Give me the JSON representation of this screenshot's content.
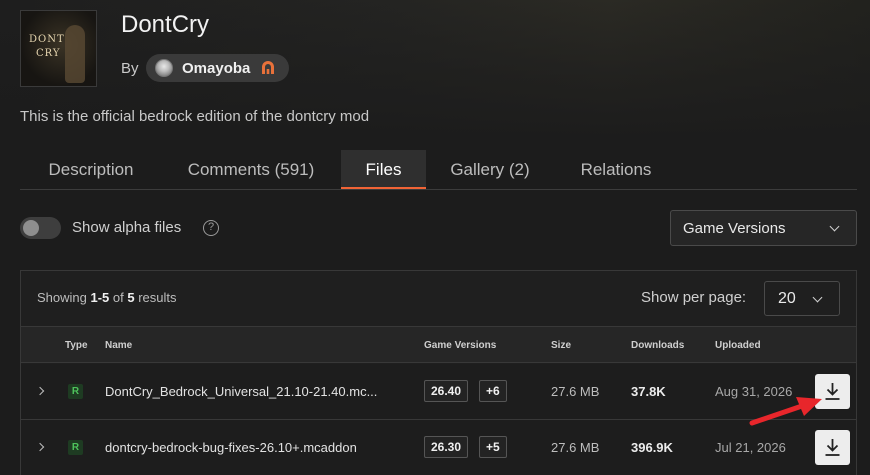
{
  "project": {
    "title": "DontCry",
    "thumb_text_1": "DONT",
    "thumb_text_2": "CRY",
    "by_label": "By",
    "author": "Omayoba",
    "description": "This is the official bedrock edition of the dontcry mod"
  },
  "tabs": [
    {
      "label": "Description",
      "active": false
    },
    {
      "label": "Comments (591)",
      "active": false
    },
    {
      "label": "Files",
      "active": true
    },
    {
      "label": "Gallery (2)",
      "active": false
    },
    {
      "label": "Relations",
      "active": false
    }
  ],
  "filters": {
    "alpha_label": "Show alpha files",
    "alpha_enabled": false,
    "help_glyph": "?",
    "game_versions_label": "Game Versions"
  },
  "results": {
    "showing_prefix": "Showing ",
    "range": "1-5",
    "of_text": " of ",
    "total": "5",
    "suffix": " results",
    "per_page_label": "Show per page:",
    "per_page_value": "20"
  },
  "table": {
    "columns": [
      "Type",
      "Name",
      "Game Versions",
      "Size",
      "Downloads",
      "Uploaded"
    ],
    "rows": [
      {
        "type": "R",
        "name": "DontCry_Bedrock_Universal_21.10-21.40.mc...",
        "version": "26.40",
        "extra_versions": "+6",
        "size": "27.6 MB",
        "downloads": "37.8K",
        "uploaded": "Aug 31, 2026"
      },
      {
        "type": "R",
        "name": "dontcry-bedrock-bug-fixes-26.10+.mcaddon",
        "version": "26.30",
        "extra_versions": "+5",
        "size": "27.6 MB",
        "downloads": "396.9K",
        "uploaded": "Jul 21, 2026"
      }
    ]
  },
  "colors": {
    "accent": "#f16436",
    "release_badge": "#4ec25c",
    "annotation_arrow": "#e8262b"
  }
}
